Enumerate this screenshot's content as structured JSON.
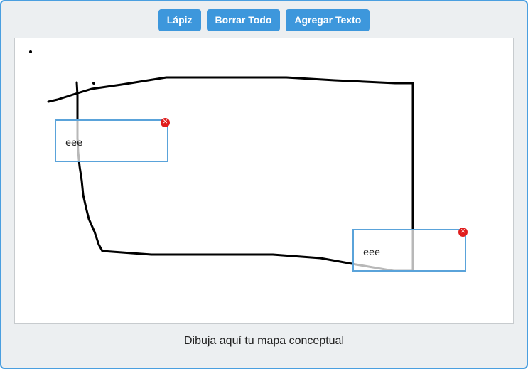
{
  "toolbar": {
    "pencil_label": "Lápiz",
    "clear_label": "Borrar Todo",
    "add_text_label": "Agregar Texto"
  },
  "canvas": {
    "stroke_color": "#000000",
    "text_boxes": [
      {
        "text": "eee",
        "delete_icon": "close-icon"
      },
      {
        "text": "eee",
        "delete_icon": "close-icon"
      }
    ]
  },
  "caption": "Dibuja aquí tu mapa conceptual",
  "colors": {
    "button_bg": "#3d97dc",
    "frame_border": "#4a9fe0",
    "textbox_border": "#5aa3da",
    "delete_badge": "#e01e1e"
  }
}
